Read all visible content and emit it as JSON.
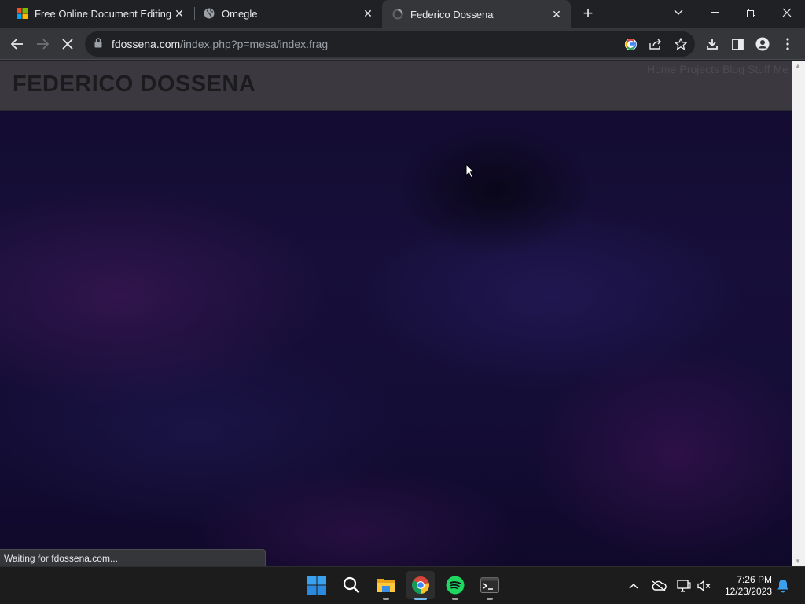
{
  "browser": {
    "tabs": [
      {
        "title": "Free Online Document Editing wi",
        "favicon": "microsoft-logo-icon",
        "active": false
      },
      {
        "title": "Omegle",
        "favicon": "globe-icon",
        "active": false
      },
      {
        "title": "Federico Dossena",
        "favicon": "loading-globe-icon",
        "active": true
      }
    ],
    "new_tab_label": "+",
    "url_domain": "fdossena.com",
    "url_path": "/index.php?p=mesa/index.frag",
    "status_text": "Waiting for fdossena.com..."
  },
  "page": {
    "site_title": "FEDERICO DOSSENA",
    "nav": [
      "Home",
      "Projects",
      "Blog",
      "Stuff",
      "Me"
    ],
    "background_colors": [
      "#120b2e",
      "#3a1a55",
      "#1f1d5c"
    ]
  },
  "taskbar": {
    "apps": [
      "start-icon",
      "search-icon",
      "file-explorer-icon",
      "chrome-icon",
      "spotify-icon",
      "terminal-icon"
    ],
    "time": "7:26 PM",
    "date": "12/23/2023"
  }
}
